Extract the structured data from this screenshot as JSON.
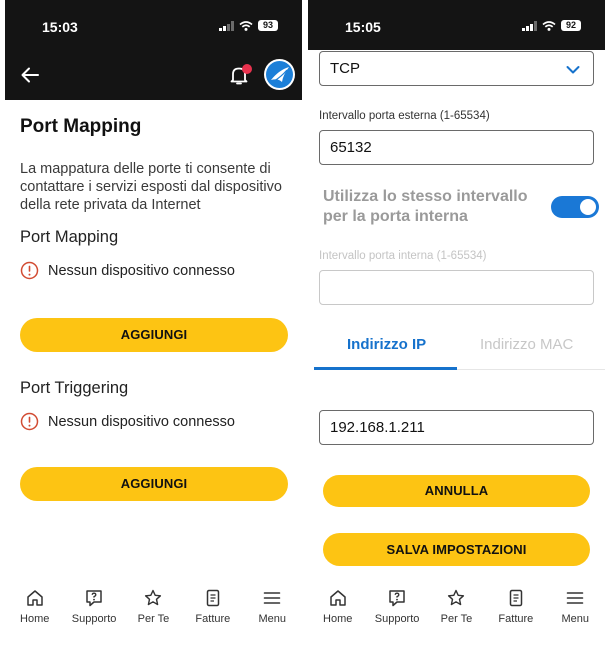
{
  "left": {
    "status": {
      "time": "15:03",
      "battery": "93"
    },
    "title": "Port Mapping",
    "description": "La mappatura delle porte ti consente di contattare i servizi esposti dal dispositivo della rete privata da Internet",
    "port_mapping": {
      "heading": "Port Mapping",
      "message": "Nessun dispositivo connesso",
      "button": "AGGIUNGI"
    },
    "port_triggering": {
      "heading": "Port Triggering",
      "message": "Nessun dispositivo connesso",
      "button": "AGGIUNGI"
    }
  },
  "right": {
    "status": {
      "time": "15:05",
      "battery": "92"
    },
    "protocol": {
      "value": "TCP"
    },
    "external_range": {
      "label": "Intervallo porta esterna (1-65534)",
      "value": "65132"
    },
    "same_range_toggle": {
      "label": "Utilizza lo stesso intervallo per la porta interna",
      "on": true
    },
    "internal_range": {
      "label": "Intervallo porta interna (1-65534)",
      "value": ""
    },
    "tabs": [
      {
        "label": "Indirizzo IP",
        "active": true
      },
      {
        "label": "Indirizzo MAC",
        "active": false
      }
    ],
    "ip_address": {
      "value": "192.168.1.211"
    },
    "cancel_button": "ANNULLA",
    "save_button": "SALVA IMPOSTAZIONI"
  },
  "nav": [
    {
      "label": "Home",
      "icon": "home-icon"
    },
    {
      "label": "Supporto",
      "icon": "support-chat-icon"
    },
    {
      "label": "Per Te",
      "icon": "star-icon"
    },
    {
      "label": "Fatture",
      "icon": "invoice-icon"
    },
    {
      "label": "Menu",
      "icon": "menu-icon"
    }
  ],
  "colors": {
    "accent_yellow": "#fdc413",
    "accent_blue": "#1672cc",
    "warning": "#d24b32",
    "status_bar": "#141414"
  }
}
